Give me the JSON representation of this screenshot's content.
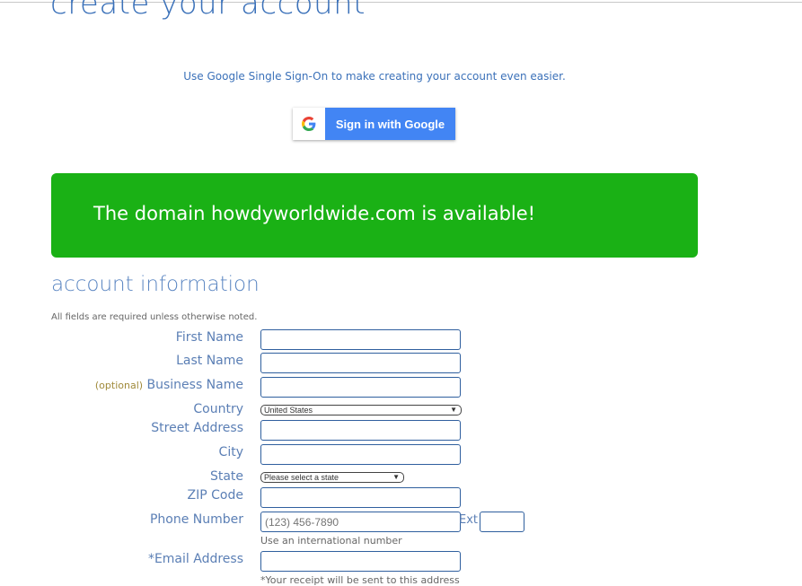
{
  "page": {
    "title": "create your account"
  },
  "sso": {
    "note": "Use Google Single Sign-On to make creating your account even easier.",
    "google_button_label": "Sign in with Google"
  },
  "banner": {
    "message": "The domain howdyworldwide.com is available!",
    "color": "#1ab115"
  },
  "account_info": {
    "section_title": "account information",
    "required_note": "All fields are required unless otherwise noted.",
    "fields": {
      "first_name": {
        "label": "First Name",
        "value": ""
      },
      "last_name": {
        "label": "Last Name",
        "value": ""
      },
      "business_name": {
        "optional_tag": "(optional)",
        "label": "Business Name",
        "value": ""
      },
      "country": {
        "label": "Country",
        "selected": "United States"
      },
      "street_address": {
        "label": "Street Address",
        "value": ""
      },
      "city": {
        "label": "City",
        "value": ""
      },
      "state": {
        "label": "State",
        "selected": "Please select a state"
      },
      "zip": {
        "label": "ZIP Code",
        "value": ""
      },
      "phone": {
        "label": "Phone Number",
        "placeholder": "(123) 456-7890",
        "ext_label": "Ext",
        "help": "Use an international number"
      },
      "email": {
        "label": "*Email Address",
        "value": "",
        "help": "*Your receipt will be sent to this address"
      }
    }
  }
}
